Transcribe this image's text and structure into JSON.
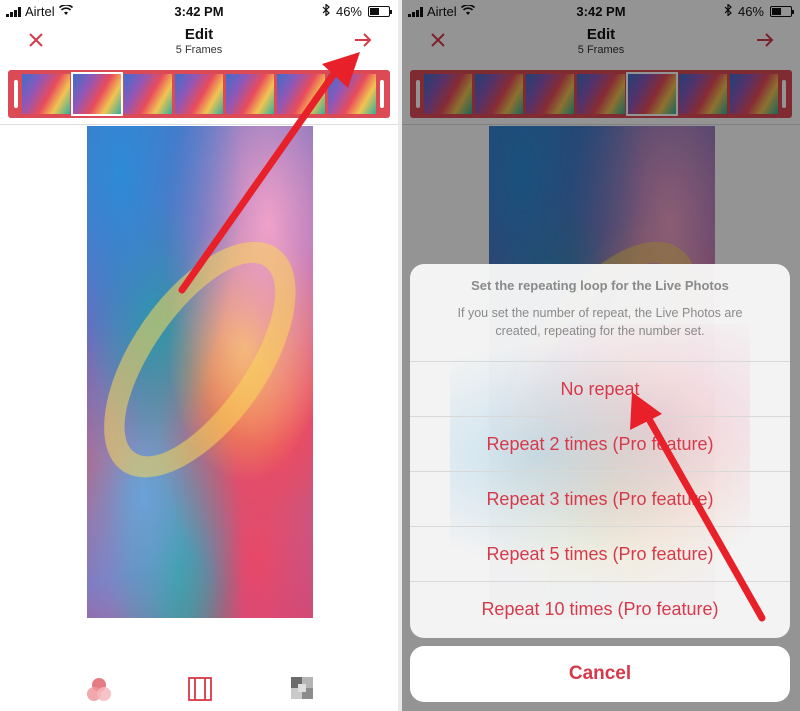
{
  "status": {
    "carrier": "Airtel",
    "time": "3:42 PM",
    "battery": "46%",
    "battery_level": 0.46
  },
  "nav": {
    "title": "Edit",
    "subtitle": "5 Frames",
    "close_icon": "close-icon",
    "next_icon": "arrow-right-icon"
  },
  "sheet": {
    "title": "Set the repeating loop for the Live Photos",
    "message": "If you set the number of repeat, the Live Photos are created, repeating for the number set.",
    "options": [
      "No repeat",
      "Repeat 2 times (Pro feature)",
      "Repeat 3 times (Pro feature)",
      "Repeat 5 times (Pro feature)",
      "Repeat 10 times (Pro feature)"
    ],
    "cancel": "Cancel"
  },
  "colors": {
    "accent": "#d63a4a",
    "timeline": "#dc4a55",
    "annotation_arrow": "#e8202a"
  }
}
